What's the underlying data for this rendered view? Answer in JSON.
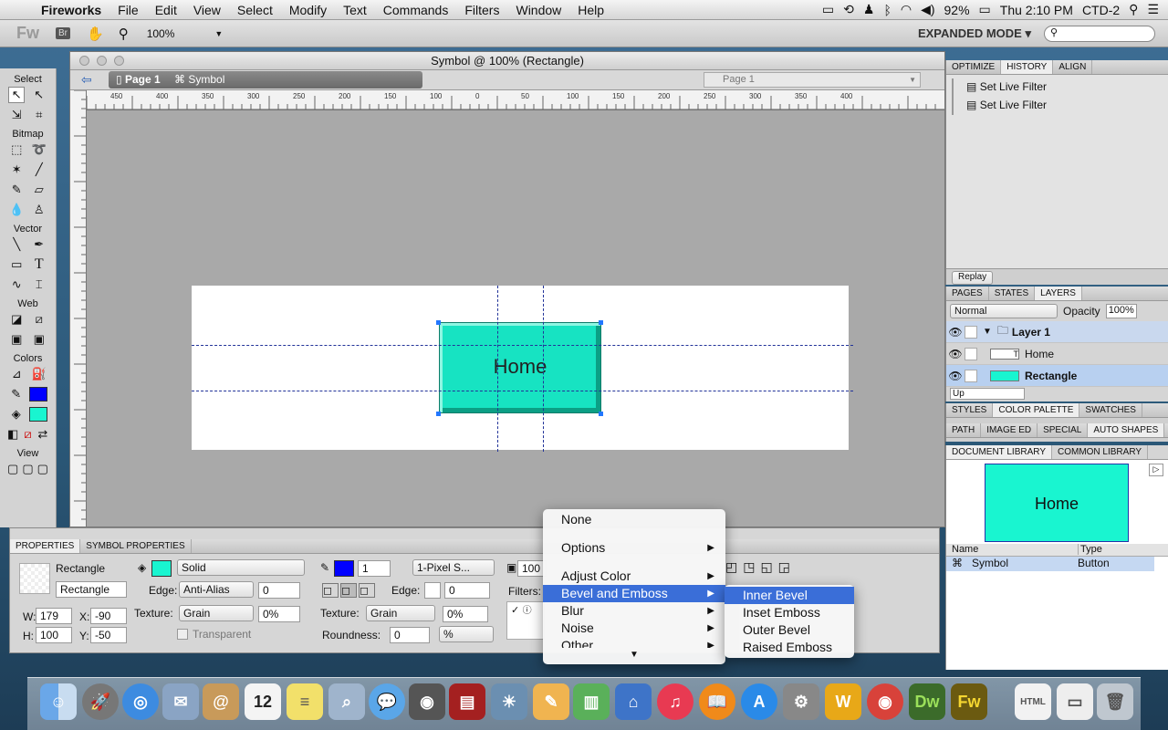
{
  "menubar": {
    "app": "Fireworks",
    "items": [
      "File",
      "Edit",
      "View",
      "Select",
      "Modify",
      "Text",
      "Commands",
      "Filters",
      "Window",
      "Help"
    ],
    "battery": "92%",
    "clock": "Thu 2:10 PM",
    "user": "CTD-2"
  },
  "toolbar": {
    "logo": "Fw",
    "br": "Br",
    "zoom": "100%",
    "mode": "EXPANDED MODE ▾"
  },
  "tools": {
    "select": "Select",
    "bitmap": "Bitmap",
    "vector": "Vector",
    "web": "Web",
    "colors": "Colors",
    "view": "View",
    "stroke_color": "#0000ff",
    "fill_color": "#19f5d0"
  },
  "document": {
    "title": "Symbol @ 100% (Rectangle)",
    "page_tab": "Page 1",
    "symbol_tab": "Symbol",
    "page_select": "Page 1",
    "button_text": "Home",
    "ruler_labels": [
      "450",
      "400",
      "350",
      "300",
      "250",
      "200",
      "150",
      "100",
      "0",
      "50",
      "100",
      "150",
      "200",
      "250",
      "300",
      "350",
      "400"
    ]
  },
  "history": {
    "tabs": [
      "OPTIMIZE",
      "HISTORY",
      "ALIGN"
    ],
    "entries": [
      "Set Live Filter",
      "Set Live Filter"
    ],
    "replay": "Replay"
  },
  "layers": {
    "tabs": [
      "PAGES",
      "STATES",
      "LAYERS"
    ],
    "blend": "Normal",
    "opacity_label": "Opacity",
    "opacity": "100%",
    "rows": [
      "Layer 1",
      "Home",
      "Rectangle"
    ],
    "state": "Up"
  },
  "styles": {
    "tabs": [
      "STYLES",
      "COLOR PALETTE",
      "SWATCHES"
    ],
    "tabs2": [
      "PATH",
      "IMAGE ED",
      "SPECIAL",
      "AUTO SHAPES"
    ]
  },
  "library": {
    "tabs": [
      "DOCUMENT LIBRARY",
      "COMMON LIBRARY"
    ],
    "preview_text": "Home",
    "col_name": "Name",
    "col_type": "Type",
    "item_name": "Symbol",
    "item_type": "Button"
  },
  "properties": {
    "tabs": [
      "PROPERTIES",
      "SYMBOL PROPERTIES"
    ],
    "object_type": "Rectangle",
    "object_name": "Rectangle",
    "fill_type": "Solid",
    "edge_label": "Edge:",
    "edge": "Anti-Alias",
    "edge_amount": "0",
    "texture_label": "Texture:",
    "texture": "Grain",
    "texture_pct": "0%",
    "transparent": "Transparent",
    "stroke_size": "1",
    "stroke_type": "1-Pixel S...",
    "stroke_edge": "0",
    "stroke_texture": "Grain",
    "stroke_texture_pct": "0%",
    "roundness_label": "Roundness:",
    "roundness": "0",
    "roundness_unit": "%",
    "w_label": "W:",
    "w": "179",
    "h_label": "H:",
    "h": "100",
    "x_label": "X:",
    "x": "-90",
    "y_label": "Y:",
    "y": "-50",
    "opacity": "100",
    "filters_label": "Filters:"
  },
  "filter_menu": {
    "items": [
      "None",
      "Options",
      "Adjust Color",
      "Bevel and Emboss",
      "Blur",
      "Noise",
      "Other"
    ],
    "submenu": [
      "Inner Bevel",
      "Inset Emboss",
      "Outer Bevel",
      "Raised Emboss"
    ]
  }
}
